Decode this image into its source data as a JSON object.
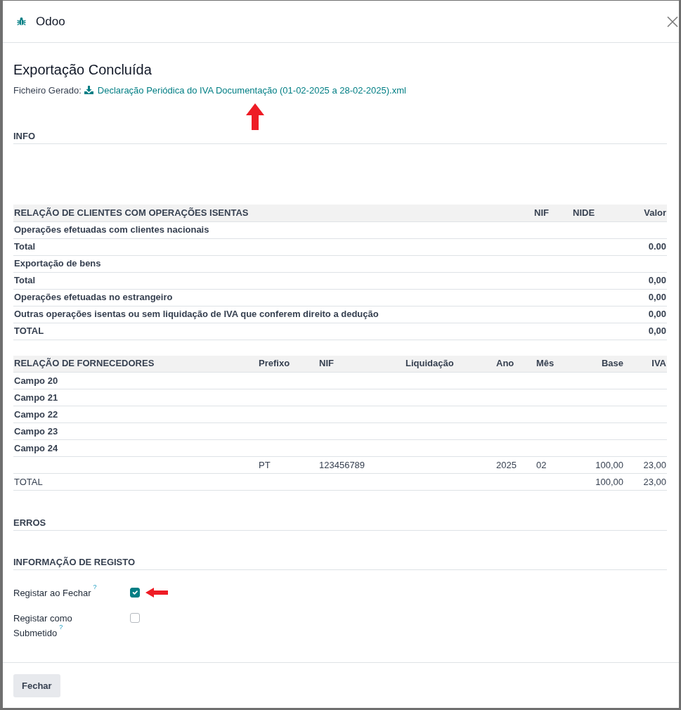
{
  "window": {
    "title": "Odoo"
  },
  "export": {
    "heading": "Exportação Concluída",
    "file_label": "Ficheiro Gerado:",
    "file_name": "Declaração Periódica do IVA Documentação (01-02-2025 a 28-02-2025).xml"
  },
  "info_section": {
    "title": "INFO"
  },
  "clients_table": {
    "columns": [
      {
        "kind": "text",
        "label": "RELAÇÃO DE CLIENTES COM OPERAÇÕES ISENTAS"
      },
      {
        "kind": "text",
        "label": "NIF"
      },
      {
        "kind": "text",
        "label": "NIDE"
      },
      {
        "kind": "amount",
        "label": "Valor"
      }
    ],
    "rows": [
      {
        "kind": "section",
        "label": "Operações efetuadas com clientes nacionais"
      },
      {
        "kind": "section",
        "label": "Total",
        "valor": "0.00"
      },
      {
        "kind": "section",
        "label": "Exportação de bens"
      },
      {
        "kind": "section",
        "label": "Total",
        "valor": "0,00"
      },
      {
        "kind": "section",
        "label": "Operações efetuadas no estrangeiro",
        "valor": "0,00"
      },
      {
        "kind": "section",
        "label": "Outras operações isentas ou sem liquidação de IVA que conferem direito a dedução",
        "valor": "0,00"
      },
      {
        "kind": "section",
        "label": "TOTAL",
        "valor": "0,00"
      }
    ]
  },
  "suppliers_table": {
    "columns": [
      {
        "kind": "text",
        "label": "RELAÇÃO DE FORNECEDORES"
      },
      {
        "kind": "text",
        "label": "Prefixo"
      },
      {
        "kind": "text",
        "label": "NIF"
      },
      {
        "kind": "text",
        "label": "Liquidação"
      },
      {
        "kind": "text",
        "label": "Ano"
      },
      {
        "kind": "text",
        "label": "Mês"
      },
      {
        "kind": "amount",
        "label": "Base"
      },
      {
        "kind": "amount",
        "label": "IVA"
      }
    ],
    "rows": [
      {
        "kind": "section",
        "label": "Campo 20"
      },
      {
        "kind": "section",
        "label": "Campo 21"
      },
      {
        "kind": "section",
        "label": "Campo 22"
      },
      {
        "kind": "section",
        "label": "Campo 23"
      },
      {
        "kind": "section",
        "label": "Campo 24"
      },
      {
        "kind": "line",
        "prefixo": "PT",
        "nif": "123456789",
        "ano": "2025",
        "mes": "02",
        "base": "100,00",
        "iva": "23,00"
      },
      {
        "kind": "line",
        "label": "TOTAL",
        "base": "100,00",
        "iva": "23,00"
      }
    ]
  },
  "errors_section": {
    "title": "ERROS"
  },
  "registration_section": {
    "title": "INFORMAÇÃO DE REGISTO",
    "fields": [
      {
        "label": "Registar ao Fechar",
        "help": "?",
        "checked": true
      },
      {
        "label": "Registar como Submetido",
        "help": "?",
        "checked": false
      }
    ]
  },
  "footer": {
    "buttons": [
      "Fechar"
    ]
  }
}
